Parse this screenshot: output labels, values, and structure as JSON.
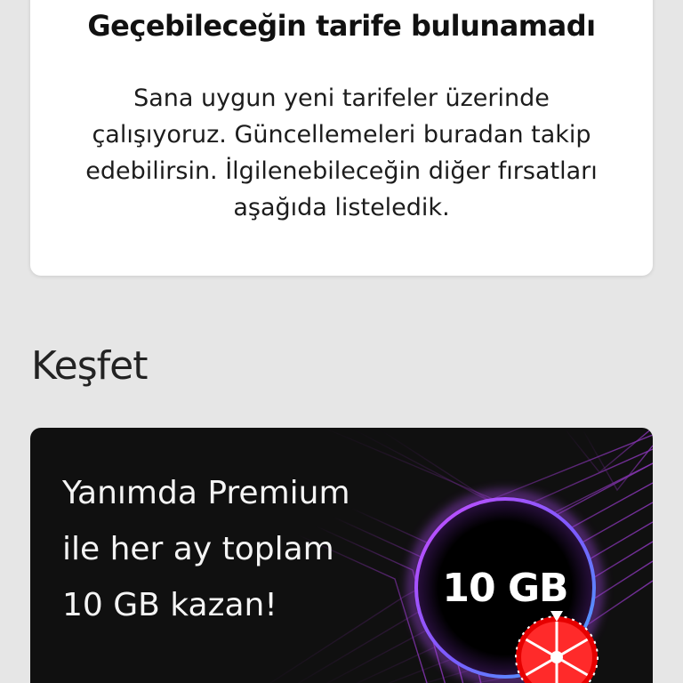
{
  "empty_state": {
    "title": "Geçebileceğin tarife bulunamadı",
    "body_lines": [
      "Sana uygun yeni tarifeler üzerinde",
      "çalışıyoruz. Güncellemeleri buradan takip",
      "edebilirsin. İlgilenebileceğin diğer fırsatları",
      "aşağıda listeledik."
    ]
  },
  "discover": {
    "title": "Keşfet"
  },
  "promo": {
    "lines": [
      "Yanımda Premium",
      "ile her ay toplam",
      "10 GB kazan!"
    ],
    "badge": "10 GB",
    "icon": "prize-wheel-icon",
    "colors": {
      "background": "#101010",
      "glow_purple": "#b44cff",
      "glow_blue": "#3fa3ff",
      "wheel_red": "#e60000"
    }
  }
}
